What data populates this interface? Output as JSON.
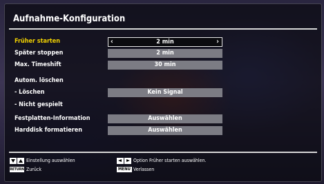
{
  "window": {
    "title": "Aufnahme-Konfiguration"
  },
  "settings": [
    {
      "label": "Früher starten",
      "value": "2 min",
      "active": true
    },
    {
      "label": "Später stoppen",
      "value": "2 min",
      "active": false
    },
    {
      "label": "Max. Timeshift",
      "value": "30 min",
      "active": false
    },
    {
      "label": "Autom. löschen",
      "value": "",
      "active": false
    },
    {
      "label": "- Löschen",
      "value": "Kein Signal",
      "active": false
    },
    {
      "label": "- Nicht gespielt",
      "value": "",
      "active": false
    },
    {
      "label": "Festplatten-Information",
      "value": "Auswählen",
      "active": false
    },
    {
      "label": "Harddisk formatieren",
      "value": "Auswählen",
      "active": false
    }
  ],
  "footer": {
    "select_hint": "Einstellung auswählen",
    "option_hint": "Option Früher starten auswählen.",
    "back_key": "RETURN",
    "back_hint": "Zurück",
    "menu_key": "MENU",
    "exit_hint": "Verlassen"
  },
  "colors": {
    "active_label": "#f2d200",
    "value_bg": "#7c7c84",
    "panel_bg": "#0a0a10"
  }
}
